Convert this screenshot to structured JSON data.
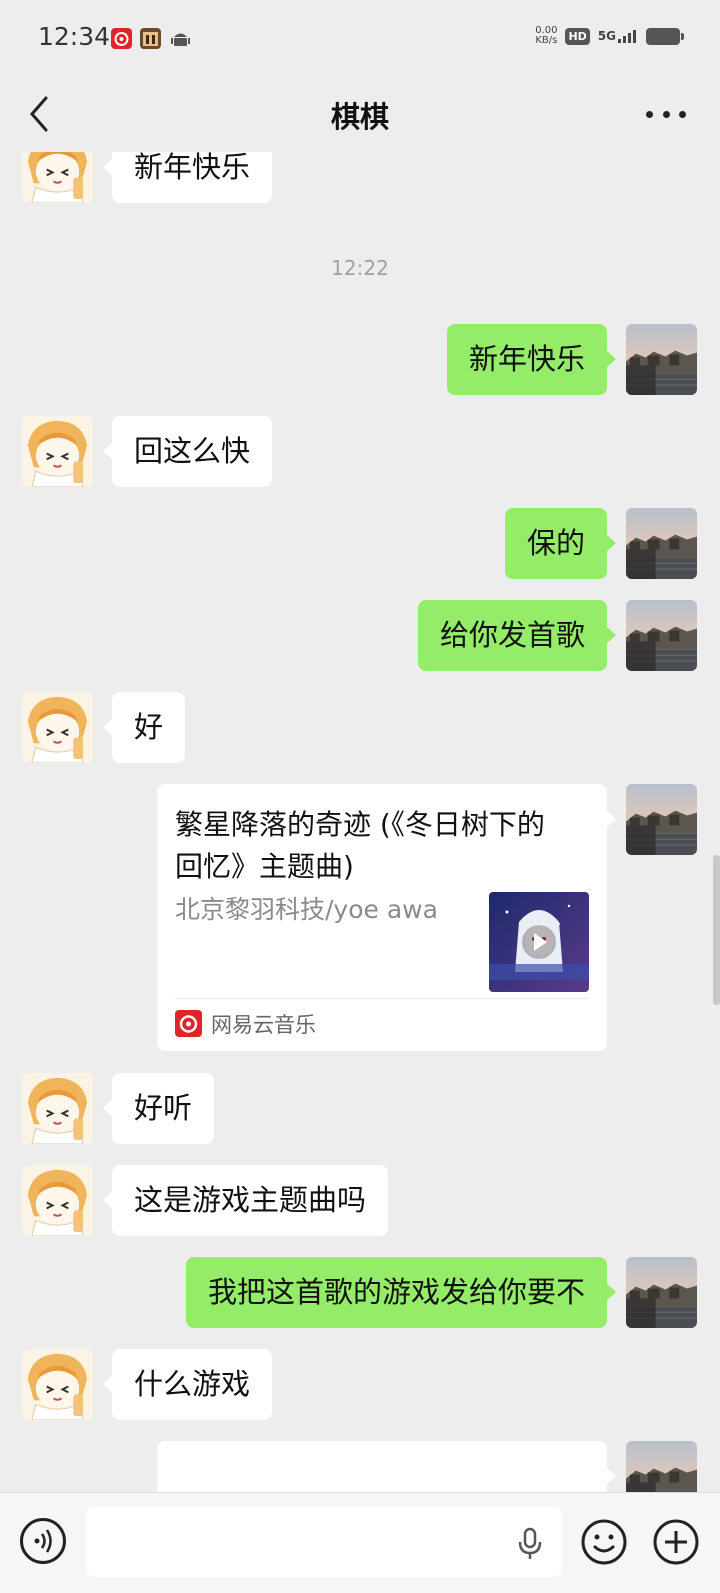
{
  "status_bar": {
    "time": "12:34",
    "net_speed_value": "0.00",
    "net_speed_unit": "KB/s",
    "hd": "HD",
    "network": "5G",
    "icons": [
      "netease-music-icon",
      "game-app-icon",
      "android-icon",
      "signal-icon",
      "battery-icon"
    ]
  },
  "header": {
    "title": "棋棋",
    "back_icon": "back-chevron-icon",
    "more_icon": "more-dots-icon"
  },
  "chat": {
    "top_partial": {
      "sender": "contact",
      "text": "新年快乐"
    },
    "timestamp": "12:22",
    "messages": [
      {
        "sender": "me",
        "text": "新年快乐"
      },
      {
        "sender": "contact",
        "text": "回这么快"
      },
      {
        "sender": "me",
        "text": "保的"
      },
      {
        "sender": "me",
        "text": "给你发首歌"
      },
      {
        "sender": "contact",
        "text": "好"
      },
      {
        "sender": "me",
        "type": "music_card",
        "title": "繁星降落的奇迹 (《冬日树下的回忆》主题曲)",
        "artist": "北京黎羽科技/yoe awa",
        "source": "网易云音乐"
      },
      {
        "sender": "contact",
        "text": "好听"
      },
      {
        "sender": "contact",
        "text": "这是游戏主题曲吗"
      },
      {
        "sender": "me",
        "text": "我把这首歌的游戏发给你要不"
      },
      {
        "sender": "contact",
        "text": "什么游戏"
      }
    ]
  },
  "input_bar": {
    "voice_icon": "voice-mode-icon",
    "mic_icon": "microphone-icon",
    "emoji_icon": "emoji-icon",
    "plus_icon": "plus-icon",
    "input_value": ""
  },
  "colors": {
    "background": "#ededed",
    "outgoing_bubble": "#95ec69",
    "incoming_bubble": "#ffffff",
    "netease_red": "#e0242a"
  }
}
